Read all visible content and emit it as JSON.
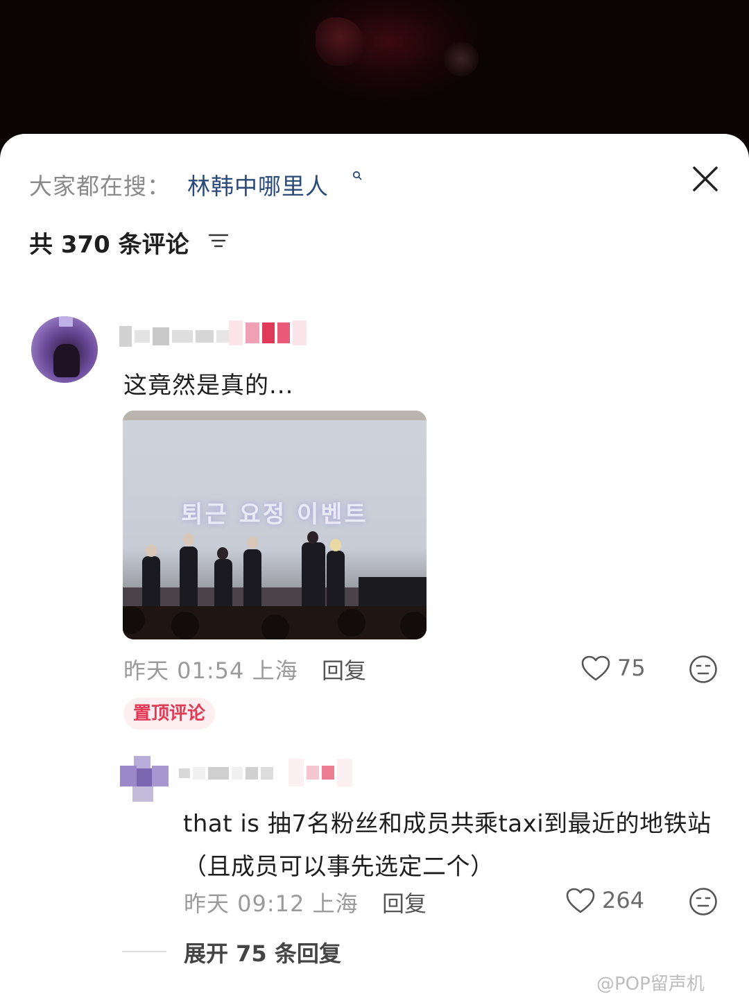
{
  "search": {
    "prefix": "大家都在搜：",
    "term": "林韩中哪里人"
  },
  "comments_header": {
    "title": "共 370 条评论"
  },
  "comment1": {
    "text": "这竟然是真的...",
    "photo_caption": "퇴근 요정 이벤트",
    "meta": "昨天 01:54 上海",
    "reply_label": "回复",
    "likes": "75",
    "pinned_label": "置顶评论"
  },
  "comment2": {
    "text": "that is 抽7名粉丝和成员共乘taxi到最近的地铁站（且成员可以事先选定二个）",
    "meta": "昨天 09:12 上海",
    "reply_label": "回复",
    "likes": "264"
  },
  "expand": {
    "label": "展开 75 条回复"
  },
  "watermark": "@POP留声机",
  "icons": {
    "search": "search-icon",
    "close": "close-icon",
    "sort": "sort-icon",
    "heart": "heart-icon",
    "dislike": "meh-face-icon"
  },
  "colors": {
    "search_term": "#2a4a7a",
    "pin_badge_text": "#e23a55",
    "pin_badge_bg": "#fdeef0"
  }
}
